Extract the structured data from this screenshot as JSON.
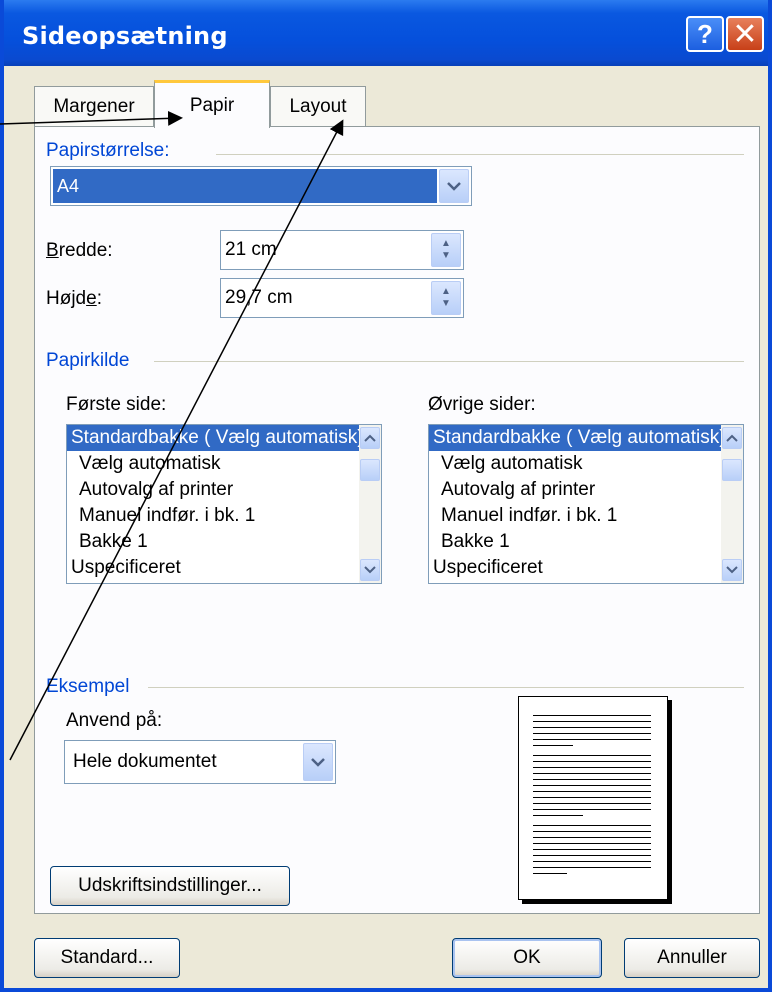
{
  "window": {
    "title": "Sideopsætning"
  },
  "tabs": [
    {
      "label": "Margener"
    },
    {
      "label": "Papir"
    },
    {
      "label": "Layout"
    }
  ],
  "paper_size": {
    "section_label": "Papirstørrelse:",
    "selected": "A4",
    "width_label": "Bredde:",
    "width_value": "21 cm",
    "height_label": "Højde:",
    "height_value": "29,7 cm"
  },
  "paper_source": {
    "section_label": "Papirkilde",
    "first_page_label": "Første side:",
    "other_pages_label": "Øvrige sider:",
    "first_page_items": [
      "Standardbakke ( Vælg automatisk)",
      "Vælg automatisk",
      "Autovalg af printer",
      "Manuel indfør. i bk. 1",
      "Bakke 1",
      "Uspecificeret"
    ],
    "other_pages_items": [
      "Standardbakke ( Vælg automatisk)",
      "Vælg automatisk",
      "Autovalg af printer",
      "Manuel indfør. i bk. 1",
      "Bakke 1",
      "Uspecificeret"
    ]
  },
  "preview": {
    "section_label": "Eksempel",
    "apply_label": "Anvend på:",
    "apply_value": "Hele dokumentet"
  },
  "buttons": {
    "print_options": "Udskriftsindstillinger...",
    "default": "Standard...",
    "ok": "OK",
    "cancel": "Annuller"
  },
  "colors": {
    "titlebar": "#0550dc",
    "selection": "#316ac5",
    "section_label": "#0046d5",
    "active_tab_highlight": "#ffc83c"
  }
}
